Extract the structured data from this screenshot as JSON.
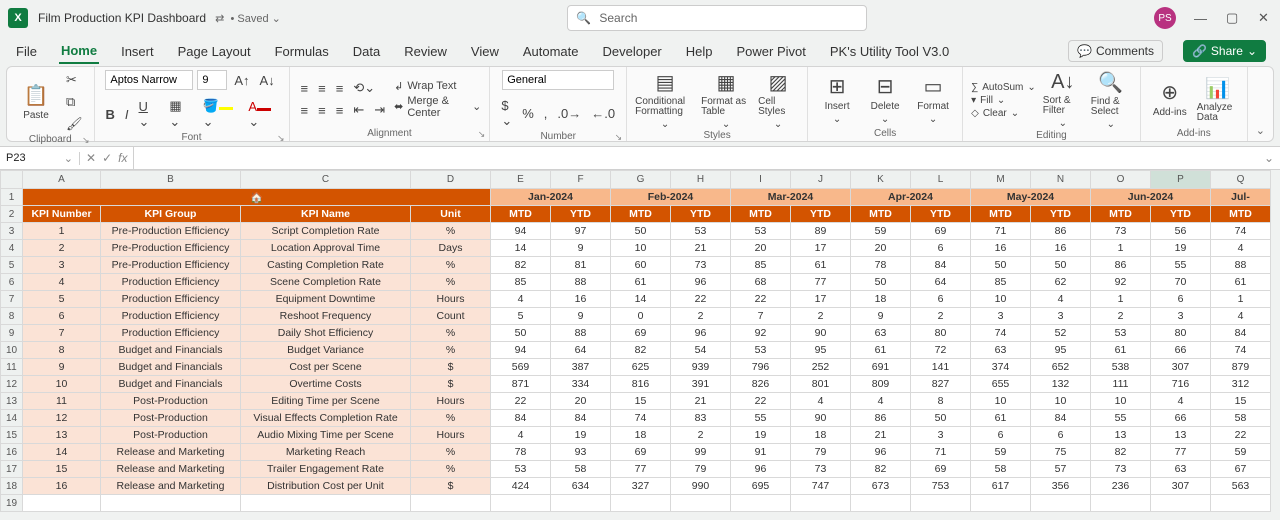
{
  "titlebar": {
    "app_short": "X",
    "doc_name": "Film Production KPI Dashboard",
    "saved_indicator": "• Saved ⌄",
    "share_icon_hint": "⇄",
    "search_placeholder": "Search",
    "avatar_initials": "PS"
  },
  "tabs": {
    "file": "File",
    "list": [
      "Home",
      "Insert",
      "Page Layout",
      "Formulas",
      "Data",
      "Review",
      "View",
      "Automate",
      "Developer",
      "Help",
      "Power Pivot",
      "PK's Utility Tool V3.0"
    ],
    "active": "Home",
    "comments": "Comments",
    "share": "Share"
  },
  "ribbon": {
    "clipboard": {
      "paste": "Paste",
      "label": "Clipboard"
    },
    "font": {
      "name": "Aptos Narrow",
      "size": "9",
      "label": "Font"
    },
    "alignment": {
      "wrap": "Wrap Text",
      "merge": "Merge & Center",
      "label": "Alignment"
    },
    "number": {
      "format": "General",
      "label": "Number"
    },
    "styles": {
      "cond": "Conditional Formatting",
      "table": "Format as Table",
      "cell": "Cell Styles",
      "label": "Styles"
    },
    "cells": {
      "insert": "Insert",
      "delete": "Delete",
      "format": "Format",
      "label": "Cells"
    },
    "editing": {
      "autosum": "AutoSum",
      "fill": "Fill",
      "clear": "Clear",
      "sort": "Sort & Filter",
      "find": "Find & Select",
      "label": "Editing"
    },
    "addins": {
      "addins": "Add-ins",
      "analyze": "Analyze Data",
      "label": "Add-ins"
    }
  },
  "formula": {
    "cell_ref": "P23"
  },
  "grid": {
    "col_letters": [
      "A",
      "B",
      "C",
      "D",
      "E",
      "F",
      "G",
      "H",
      "I",
      "J",
      "K",
      "L",
      "M",
      "N",
      "O",
      "P",
      "Q"
    ],
    "months": [
      "Jan-2024",
      "Feb-2024",
      "Mar-2024",
      "Apr-2024",
      "May-2024",
      "Jun-2024",
      "Jul-"
    ],
    "headers": [
      "KPI Number",
      "KPI Group",
      "KPI Name",
      "Unit"
    ],
    "mtd": "MTD",
    "ytd": "YTD",
    "rows": [
      {
        "n": "1",
        "g": "Pre-Production Efficiency",
        "k": "Script Completion Rate",
        "u": "%",
        "v": [
          "94",
          "97",
          "50",
          "53",
          "53",
          "89",
          "59",
          "69",
          "71",
          "86",
          "73",
          "56",
          "74"
        ]
      },
      {
        "n": "2",
        "g": "Pre-Production Efficiency",
        "k": "Location Approval Time",
        "u": "Days",
        "v": [
          "14",
          "9",
          "10",
          "21",
          "20",
          "17",
          "20",
          "6",
          "16",
          "16",
          "1",
          "19",
          "4"
        ]
      },
      {
        "n": "3",
        "g": "Pre-Production Efficiency",
        "k": "Casting Completion Rate",
        "u": "%",
        "v": [
          "82",
          "81",
          "60",
          "73",
          "85",
          "61",
          "78",
          "84",
          "50",
          "50",
          "86",
          "55",
          "88"
        ]
      },
      {
        "n": "4",
        "g": "Production Efficiency",
        "k": "Scene Completion Rate",
        "u": "%",
        "v": [
          "85",
          "88",
          "61",
          "96",
          "68",
          "77",
          "50",
          "64",
          "85",
          "62",
          "92",
          "70",
          "61"
        ]
      },
      {
        "n": "5",
        "g": "Production Efficiency",
        "k": "Equipment Downtime",
        "u": "Hours",
        "v": [
          "4",
          "16",
          "14",
          "22",
          "22",
          "17",
          "18",
          "6",
          "10",
          "4",
          "1",
          "6",
          "1"
        ]
      },
      {
        "n": "6",
        "g": "Production Efficiency",
        "k": "Reshoot Frequency",
        "u": "Count",
        "v": [
          "5",
          "9",
          "0",
          "2",
          "7",
          "2",
          "9",
          "2",
          "3",
          "3",
          "2",
          "3",
          "4"
        ]
      },
      {
        "n": "7",
        "g": "Production Efficiency",
        "k": "Daily Shot Efficiency",
        "u": "%",
        "v": [
          "50",
          "88",
          "69",
          "96",
          "92",
          "90",
          "63",
          "80",
          "74",
          "52",
          "53",
          "80",
          "84"
        ]
      },
      {
        "n": "8",
        "g": "Budget and Financials",
        "k": "Budget Variance",
        "u": "%",
        "v": [
          "94",
          "64",
          "82",
          "54",
          "53",
          "95",
          "61",
          "72",
          "63",
          "95",
          "61",
          "66",
          "74"
        ]
      },
      {
        "n": "9",
        "g": "Budget and Financials",
        "k": "Cost per Scene",
        "u": "$",
        "v": [
          "569",
          "387",
          "625",
          "939",
          "796",
          "252",
          "691",
          "141",
          "374",
          "652",
          "538",
          "307",
          "879"
        ]
      },
      {
        "n": "10",
        "g": "Budget and Financials",
        "k": "Overtime Costs",
        "u": "$",
        "v": [
          "871",
          "334",
          "816",
          "391",
          "826",
          "801",
          "809",
          "827",
          "655",
          "132",
          "111",
          "716",
          "312"
        ]
      },
      {
        "n": "11",
        "g": "Post-Production",
        "k": "Editing Time per Scene",
        "u": "Hours",
        "v": [
          "22",
          "20",
          "15",
          "21",
          "22",
          "4",
          "4",
          "8",
          "10",
          "10",
          "10",
          "4",
          "15"
        ]
      },
      {
        "n": "12",
        "g": "Post-Production",
        "k": "Visual Effects Completion Rate",
        "u": "%",
        "v": [
          "84",
          "84",
          "74",
          "83",
          "55",
          "90",
          "86",
          "50",
          "61",
          "84",
          "55",
          "66",
          "58"
        ]
      },
      {
        "n": "13",
        "g": "Post-Production",
        "k": "Audio Mixing Time per Scene",
        "u": "Hours",
        "v": [
          "4",
          "19",
          "18",
          "2",
          "19",
          "18",
          "21",
          "3",
          "6",
          "6",
          "13",
          "13",
          "22"
        ]
      },
      {
        "n": "14",
        "g": "Release and Marketing",
        "k": "Marketing Reach",
        "u": "%",
        "v": [
          "78",
          "93",
          "69",
          "99",
          "91",
          "79",
          "96",
          "71",
          "59",
          "75",
          "82",
          "77",
          "59"
        ]
      },
      {
        "n": "15",
        "g": "Release and Marketing",
        "k": "Trailer Engagement Rate",
        "u": "%",
        "v": [
          "53",
          "58",
          "77",
          "79",
          "96",
          "73",
          "82",
          "69",
          "58",
          "57",
          "73",
          "63",
          "67"
        ]
      },
      {
        "n": "16",
        "g": "Release and Marketing",
        "k": "Distribution Cost per Unit",
        "u": "$",
        "v": [
          "424",
          "634",
          "327",
          "990",
          "695",
          "747",
          "673",
          "753",
          "617",
          "356",
          "236",
          "307",
          "563"
        ]
      }
    ]
  }
}
